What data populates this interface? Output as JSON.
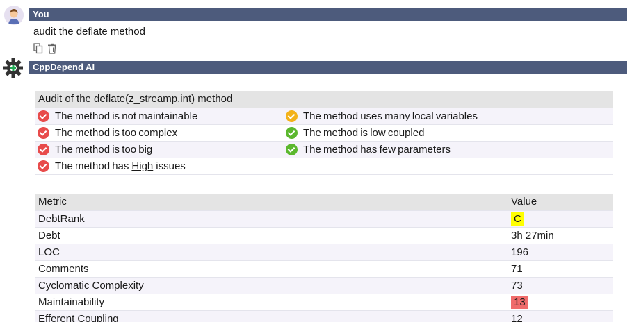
{
  "user": {
    "name": "You",
    "message": "audit the deflate method"
  },
  "ai": {
    "name": "CppDepend AI"
  },
  "audit": {
    "title": "Audit of the deflate(z_streamp,int) method",
    "left": [
      {
        "text": "The method is not maintainable",
        "status": "bad"
      },
      {
        "text": "The method is too complex",
        "status": "bad"
      },
      {
        "text": "The method is too big",
        "status": "bad"
      }
    ],
    "right": [
      {
        "text": "The method uses many local variables",
        "status": "warn"
      },
      {
        "text": "The method is low coupled",
        "status": "ok"
      },
      {
        "text": "The method has few parameters",
        "status": "ok"
      }
    ],
    "issues": {
      "prefix": "The method has",
      "level": "High",
      "suffix": "issues"
    }
  },
  "metrics": {
    "header": {
      "metric": "Metric",
      "value": "Value"
    },
    "rows": [
      {
        "metric": "DebtRank",
        "value": "C",
        "highlight": "#ffff00"
      },
      {
        "metric": "Debt",
        "value": "3h  27min"
      },
      {
        "metric": "LOC",
        "value": "196"
      },
      {
        "metric": "Comments",
        "value": "71"
      },
      {
        "metric": "Cyclomatic Complexity",
        "value": "73"
      },
      {
        "metric": "Maintainability",
        "value": "13",
        "highlight": "#f06b6b"
      },
      {
        "metric": "Efferent Coupling",
        "value": "12"
      }
    ]
  },
  "colors": {
    "bar": "#4d5b7c",
    "bad": "#e84b4b",
    "warn": "#f3b21a",
    "ok": "#5cb82e"
  },
  "icons": {
    "user": "user-avatar-icon",
    "ai": "gear-icon",
    "copy": "copy-icon",
    "delete": "trash-icon"
  }
}
